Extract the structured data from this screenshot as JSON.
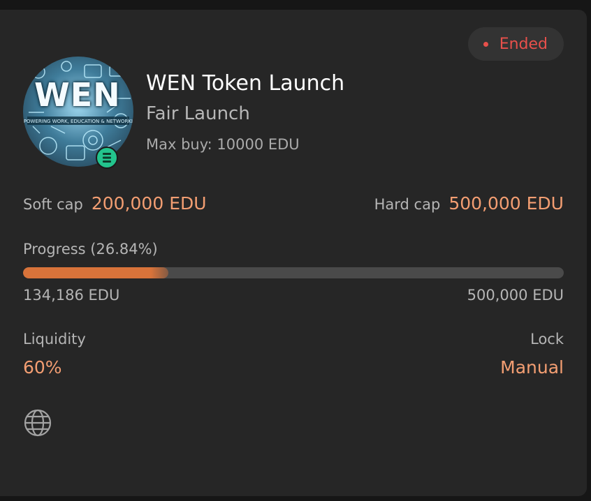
{
  "status": {
    "label": "Ended",
    "color": "#e8504b"
  },
  "project": {
    "logo_text": "WEN",
    "title": "WEN Token Launch",
    "type": "Fair Launch",
    "max_buy": "Max buy: 10000 EDU",
    "chain_icon": "edu-chain-icon"
  },
  "caps": {
    "soft_label": "Soft cap",
    "soft_value": "200,000 EDU",
    "hard_label": "Hard cap",
    "hard_value": "500,000 EDU"
  },
  "progress": {
    "label": "Progress (26.84%)",
    "percent": 26.84,
    "raised": "134,186 EDU",
    "target": "500,000 EDU"
  },
  "liquidity": {
    "label": "Liquidity",
    "value": "60%"
  },
  "lock": {
    "label": "Lock",
    "value": "Manual"
  },
  "links": [
    {
      "icon": "globe-icon"
    }
  ],
  "colors": {
    "accent": "#f39e72",
    "progress_fill": "#d8733a",
    "card_bg": "#262626"
  }
}
